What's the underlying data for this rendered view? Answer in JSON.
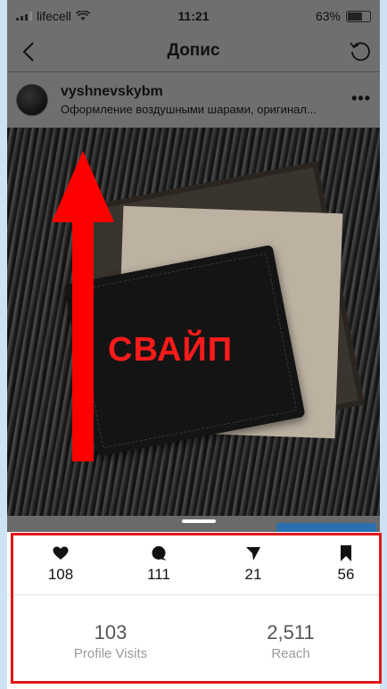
{
  "status": {
    "carrier": "lifecell",
    "time": "11:21",
    "battery": "63%",
    "battery_level": 0.63
  },
  "nav": {
    "title": "Допис"
  },
  "post": {
    "username": "vyshnevskybm",
    "caption": "Оформление воздушными шарами, оригинал..."
  },
  "overlay": {
    "swipe_text": "СВАЙП"
  },
  "stats": {
    "likes": "108",
    "comments": "111",
    "shares": "21",
    "saves": "56",
    "profile_visits": "103",
    "profile_visits_label": "Profile Visits",
    "reach": "2,511",
    "reach_label": "Reach"
  },
  "colors": {
    "highlight": "#e01818",
    "swipe_text": "#ff1b1b",
    "arrow": "#ff0000",
    "button": "#2a6fb0"
  },
  "icons": {
    "back": "chevron-left-icon",
    "refresh": "refresh-icon",
    "more": "more-horizontal-icon",
    "like": "heart-icon",
    "comment": "comment-bubble-icon",
    "share": "send-icon",
    "save": "bookmark-icon"
  }
}
